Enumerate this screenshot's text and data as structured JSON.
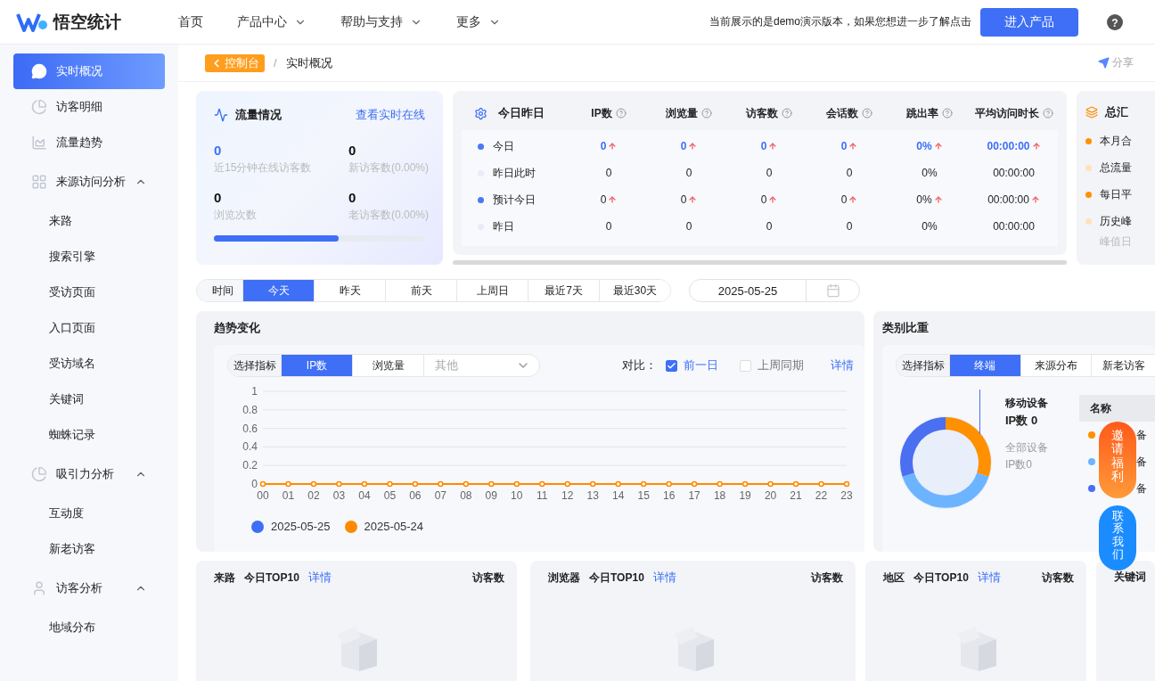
{
  "header": {
    "logo": "悟空统计",
    "nav": [
      {
        "label": "首页",
        "has_menu": false
      },
      {
        "label": "产品中心",
        "has_menu": true
      },
      {
        "label": "帮助与支持",
        "has_menu": true
      },
      {
        "label": "更多",
        "has_menu": true
      }
    ],
    "notice": "当前展示的是demo演示版本，如果您想进一步了解点击",
    "cta": "进入产品",
    "help_glyph": "?"
  },
  "sidebar": {
    "items": [
      {
        "label": "实时概况",
        "selected": true
      },
      {
        "label": "访客明细",
        "selected": false
      },
      {
        "label": "流量趋势",
        "selected": false
      },
      {
        "label": "来源访问分析",
        "selected": false,
        "expanded": true,
        "children": [
          {
            "label": "来路",
            "selected": false
          },
          {
            "label": "搜索引擎",
            "selected": false
          },
          {
            "label": "受访页面",
            "selected": false
          },
          {
            "label": "入口页面",
            "selected": false
          },
          {
            "label": "受访域名",
            "selected": false
          },
          {
            "label": "关键词",
            "selected": false
          },
          {
            "label": "蜘蛛记录",
            "selected": false
          }
        ]
      },
      {
        "label": "吸引力分析",
        "selected": false,
        "expanded": true,
        "children": [
          {
            "label": "互动度",
            "selected": false
          },
          {
            "label": "新老访客",
            "selected": false
          }
        ]
      },
      {
        "label": "访客分析",
        "selected": false,
        "expanded": true,
        "children": [
          {
            "label": "地域分布",
            "selected": false
          }
        ]
      }
    ]
  },
  "breadcrumb": {
    "back": "控制台",
    "separator": "/",
    "current": "实时概况",
    "share": "分享"
  },
  "flow": {
    "title": "流量情况",
    "link": "查看实时在线",
    "stats": [
      {
        "value": "0",
        "label": "近15分钟在线访客数",
        "highlight": true
      },
      {
        "value": "0",
        "label": "新访客数(0.00%)",
        "highlight": false
      },
      {
        "value": "0",
        "label": "浏览次数",
        "highlight": false
      },
      {
        "value": "0",
        "label": "老访客数(0.00%)",
        "highlight": false
      }
    ],
    "progress": {
      "level": 0.59
    }
  },
  "today": {
    "title": "今日昨日",
    "columns": [
      "IP数",
      "浏览量",
      "访客数",
      "会话数",
      "跳出率",
      "平均访问时长"
    ],
    "rows": [
      {
        "label": "今日",
        "color": "#4a78f5",
        "emphasis": true,
        "cells": [
          {
            "text": "0",
            "up": true
          },
          {
            "text": "0",
            "up": true
          },
          {
            "text": "0",
            "up": true
          },
          {
            "text": "0",
            "up": true
          },
          {
            "text": "0%",
            "up": true
          },
          {
            "text": "00:00:00",
            "up": true
          }
        ]
      },
      {
        "label": "昨日此时",
        "color": "#e8ebfa",
        "emphasis": false,
        "cells": [
          {
            "text": "0",
            "up": false
          },
          {
            "text": "0",
            "up": false
          },
          {
            "text": "0",
            "up": false
          },
          {
            "text": "0",
            "up": false
          },
          {
            "text": "0%",
            "up": false
          },
          {
            "text": "00:00:00",
            "up": false
          }
        ]
      },
      {
        "label": "预计今日",
        "color": "#4a78f5",
        "emphasis": false,
        "cells": [
          {
            "text": "0",
            "up": true
          },
          {
            "text": "0",
            "up": true
          },
          {
            "text": "0",
            "up": true
          },
          {
            "text": "0",
            "up": true
          },
          {
            "text": "0%",
            "up": true
          },
          {
            "text": "00:00:00",
            "up": true
          }
        ]
      },
      {
        "label": "昨日",
        "color": "#e8ebfa",
        "emphasis": false,
        "cells": [
          {
            "text": "0",
            "up": false
          },
          {
            "text": "0",
            "up": false
          },
          {
            "text": "0",
            "up": false
          },
          {
            "text": "0",
            "up": false
          },
          {
            "text": "0%",
            "up": false
          },
          {
            "text": "00:00:00",
            "up": false
          }
        ]
      }
    ]
  },
  "summary": {
    "title": "总汇",
    "items": [
      {
        "label": "本月合",
        "color": "#ff9000"
      },
      {
        "label": "总流量",
        "color": "#ffe2b8"
      },
      {
        "label": "每日平",
        "color": "#ff9000"
      },
      {
        "label": "历史峰",
        "color": "#ffe2b8"
      }
    ],
    "note": "峰值日"
  },
  "date_filter": {
    "label": "时间",
    "options": [
      {
        "label": "今天",
        "selected": true
      },
      {
        "label": "昨天",
        "selected": false
      },
      {
        "label": "前天",
        "selected": false
      },
      {
        "label": "上周日",
        "selected": false
      },
      {
        "label": "最近7天",
        "selected": false
      },
      {
        "label": "最近30天",
        "selected": false
      }
    ],
    "date": "2025-05-25"
  },
  "trend": {
    "title": "趋势变化",
    "metric_label": "选择指标",
    "metrics": [
      {
        "label": "IP数",
        "selected": true
      },
      {
        "label": "浏览量",
        "selected": false
      }
    ],
    "other_placeholder": "其他",
    "compare_label": "对比：",
    "compare": [
      {
        "label": "前一日",
        "checked": true
      },
      {
        "label": "上周同期",
        "checked": false
      }
    ],
    "detail_link": "详情",
    "chart_data": {
      "type": "line",
      "categories": [
        "00",
        "01",
        "02",
        "03",
        "04",
        "05",
        "06",
        "07",
        "08",
        "09",
        "10",
        "11",
        "12",
        "13",
        "14",
        "15",
        "16",
        "17",
        "18",
        "19",
        "20",
        "21",
        "22",
        "23"
      ],
      "ylim": [
        0,
        1
      ],
      "grid": true,
      "yticks": [
        0,
        0.2,
        0.4,
        0.6,
        0.8,
        1
      ],
      "series": [
        {
          "name": "2025-05-25",
          "color": "#3e6ff6",
          "values": [
            null,
            null,
            null,
            null,
            null,
            null,
            null,
            null,
            null,
            null,
            null,
            null,
            null,
            null,
            null,
            null,
            null,
            null,
            null,
            null,
            null,
            null,
            null,
            null
          ]
        },
        {
          "name": "2025-05-24",
          "color": "#ff8a00",
          "marker": "circle",
          "values": [
            0,
            0,
            0,
            0,
            0,
            0,
            0,
            0,
            0,
            0,
            0,
            0,
            0,
            0,
            0,
            0,
            0,
            0,
            0,
            0,
            0,
            0,
            0,
            0
          ]
        }
      ]
    }
  },
  "category": {
    "title": "类别比重",
    "metric_label": "选择指标",
    "tabs": [
      {
        "label": "终端",
        "selected": true
      },
      {
        "label": "来源分布",
        "selected": false
      },
      {
        "label": "新老访客",
        "selected": false
      }
    ],
    "callout": {
      "name": "移动设备",
      "value": "IP数 0",
      "total_label": "全部设备",
      "total_value": "IP数0"
    },
    "table_header": "名称",
    "legend": [
      {
        "label": "备",
        "color": "#ff9000"
      },
      {
        "label": "备",
        "color": "#6cb4ff"
      },
      {
        "label": "备",
        "color": "#4a6ff0"
      }
    ]
  },
  "top_cards": [
    {
      "title": "来路",
      "subtitle": "今日TOP10",
      "link": "详情",
      "column": "访客数"
    },
    {
      "title": "浏览器",
      "subtitle": "今日TOP10",
      "link": "详情",
      "column": "访客数"
    },
    {
      "title": "地区",
      "subtitle": "今日TOP10",
      "link": "详情",
      "column": "访客数"
    },
    {
      "title": "关键词"
    }
  ],
  "floats": [
    {
      "label": "邀请福利",
      "kind": "promo"
    },
    {
      "label": "联系我们",
      "kind": "contact"
    }
  ]
}
